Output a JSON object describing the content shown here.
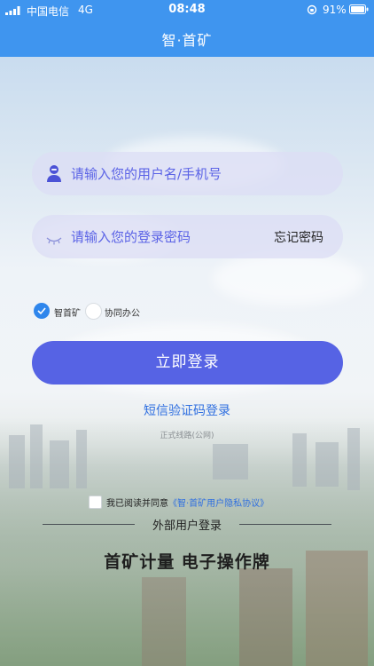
{
  "status": {
    "carrier": "中国电信",
    "network": "4G",
    "time": "08:48",
    "battery": "91%"
  },
  "nav": {
    "title": "智·首矿"
  },
  "login": {
    "username_placeholder": "请输入您的用户名/手机号",
    "password_placeholder": "请输入您的登录密码",
    "forgot_label": "忘记密码",
    "options": [
      {
        "label": "智首矿",
        "checked": true
      },
      {
        "label": "协同办公",
        "checked": false
      }
    ],
    "submit_label": "立即登录",
    "sms_login_label": "短信验证码登录",
    "line_note": "正式线路(公网)",
    "agree_prefix": "我已阅读并同意",
    "agree_link": "《智·首矿用户隐私协议》"
  },
  "external": {
    "divider_label": "外部用户登录",
    "footer_title": "首矿计量  电子操作牌"
  },
  "colors": {
    "header": "#3f95ef",
    "accent": "#5663e4",
    "link": "#2f6fe0"
  },
  "icons": [
    "signal-icon",
    "battery-icon",
    "user-icon",
    "eye-closed-icon",
    "check-icon"
  ]
}
